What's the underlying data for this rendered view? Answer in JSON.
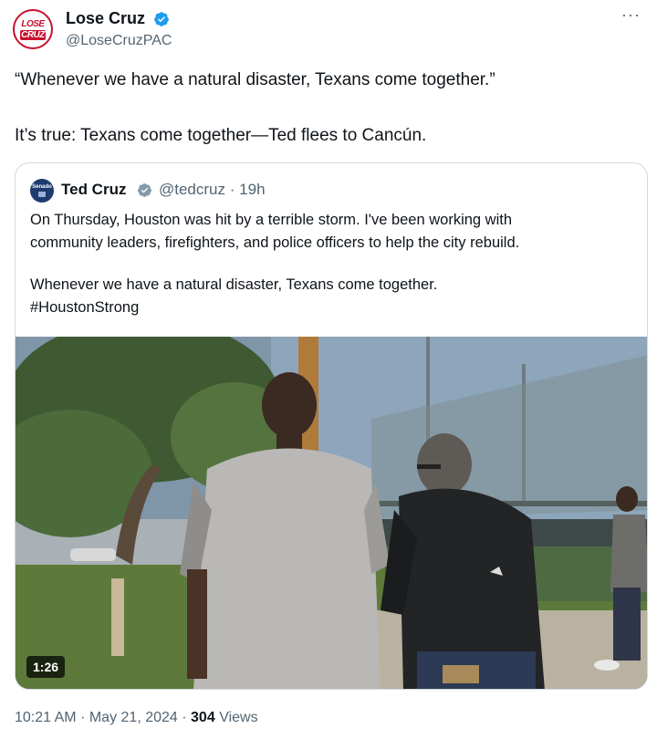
{
  "author": {
    "name": "Lose Cruz",
    "handle": "@LoseCruzPAC",
    "avatar_text_top": "LOSE",
    "avatar_text_bottom": "CRUZ"
  },
  "more_icon": "···",
  "post_text": {
    "line1": "“Whenever we have a natural disaster, Texans come together.”",
    "line2": "It’s true: Texans come together—Ted flees to Cancún."
  },
  "quoted": {
    "avatar_text": "Senado",
    "name": "Ted Cruz",
    "handle": "@tedcruz",
    "separator": "·",
    "age": "19h",
    "text_line1": "On Thursday, Houston was hit by a terrible storm. I've been working with",
    "text_line2": "community leaders, firefighters, and police officers to help the city rebuild.",
    "text_line3": "Whenever we have a natural disaster, Texans come together.",
    "text_line4": "#HoustonStrong",
    "video_duration": "1:26"
  },
  "footer": {
    "time": "10:21 AM",
    "sep1": "·",
    "date": "May 21, 2024",
    "sep2": "·",
    "views_count": "304",
    "views_label": "Views"
  },
  "colors": {
    "verified": "#1d9bf0",
    "verified_gray": "#829aab",
    "brand_red": "#c8102e",
    "muted_text": "#536471"
  }
}
